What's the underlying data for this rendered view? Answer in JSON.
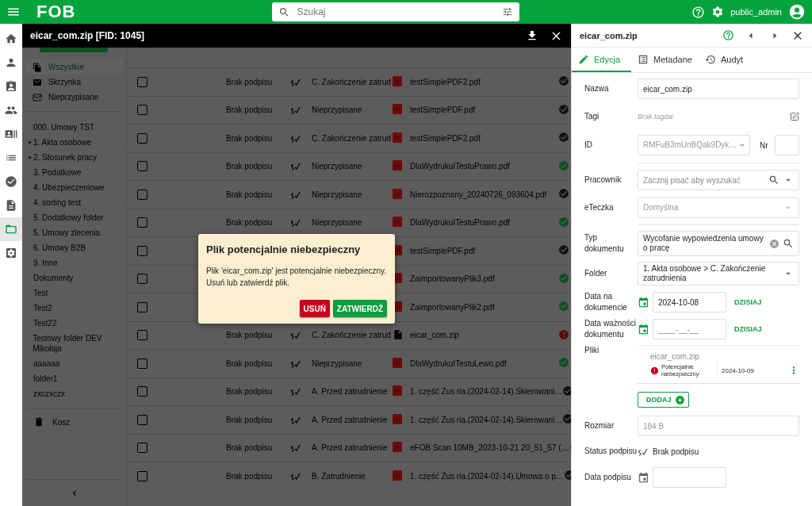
{
  "topbar": {
    "logo": "FOB",
    "search": {
      "placeholder": "Szukaj"
    },
    "user": "public_admin"
  },
  "rail": [
    {
      "selected": false
    },
    {
      "selected": false
    },
    {
      "selected": false
    },
    {
      "selected": false
    },
    {
      "selected": false
    },
    {
      "selected": false
    },
    {
      "selected": false
    },
    {
      "selected": false
    },
    {
      "selected": true
    },
    {
      "selected": false
    }
  ],
  "viewer": {
    "title": "eicar_com.zip [FID: 1045]"
  },
  "folders": {
    "quick": [
      {
        "label": "Wszystkie",
        "selected": true
      },
      {
        "label": "Skrzynka",
        "selected": false
      },
      {
        "label": "Nieprzypisane",
        "selected": false
      }
    ],
    "tree": [
      {
        "label": "000. Umowy TST",
        "expandable": false
      },
      {
        "label": "1. Akta osobowe",
        "expandable": true
      },
      {
        "label": "2. Stosunek pracy",
        "expandable": true
      },
      {
        "label": "3. Podatkowe",
        "expandable": false
      },
      {
        "label": "4. Ubezpieczeniowe",
        "expandable": false
      },
      {
        "label": "4. sorting test",
        "expandable": false
      },
      {
        "label": "5. Dodatkowy folder",
        "expandable": false
      },
      {
        "label": "5. Umowy zlecenia",
        "expandable": false
      },
      {
        "label": "6. Umowy B2B",
        "expandable": false
      },
      {
        "label": "9. Inne",
        "expandable": false
      },
      {
        "label": "Dokumenty",
        "expandable": false
      },
      {
        "label": "Test",
        "expandable": false
      },
      {
        "label": "Test2",
        "expandable": false
      },
      {
        "label": "Test22",
        "expandable": false
      },
      {
        "label": "Testowy folder DEV Mikołaja",
        "expandable": false
      },
      {
        "label": "aaaaaa",
        "expandable": false
      },
      {
        "label": "folder1",
        "expandable": false
      },
      {
        "label": "zxczxczx",
        "expandable": false
      }
    ],
    "trash": "Kosz"
  },
  "table": {
    "rows": [
      {
        "checked": false,
        "signature": "Brak podpisu",
        "folder": "C. Zakończenie zatrud",
        "kind": "pdf",
        "file": "testSimplePDF2.pdf",
        "verified": false,
        "danger": false
      },
      {
        "checked": false,
        "signature": "Brak podpisu",
        "folder": "Nieprzypisane",
        "kind": "pdf",
        "file": "testSimplePDF.pdf",
        "verified": false,
        "danger": false
      },
      {
        "checked": false,
        "signature": "Brak podpisu",
        "folder": "C. Zakończenie zatrud",
        "kind": "pdf",
        "file": "testSimplePDF2.pdf",
        "verified": false,
        "danger": false
      },
      {
        "checked": false,
        "signature": "Brak podpisu",
        "folder": "Nieprzypisane",
        "kind": "pdf",
        "file": "DlaWydrukuITestuPrawo.pdf",
        "verified": true,
        "danger": false
      },
      {
        "checked": false,
        "signature": "Brak podpisu",
        "folder": "Nieprzypisane",
        "kind": "pdf",
        "file": "Nierozpoznany_20240726_093604.pdf",
        "verified": false,
        "danger": false
      },
      {
        "checked": false,
        "signature": "Brak podpisu",
        "folder": "Nieprzypisane",
        "kind": "pdf",
        "file": "DlaWydrukuITestuPrawo.pdf",
        "verified": true,
        "danger": false
      },
      {
        "checked": false,
        "kind": "pdf",
        "file": "testSimplePDF.pdf",
        "verified": false,
        "danger": false
      },
      {
        "checked": false,
        "kind": "pdf",
        "file": "ZaimportowanyPlik3.pdf",
        "verified": true,
        "danger": false
      },
      {
        "checked": false,
        "kind": "pdf",
        "file": "ZaimportowanyPlik2.pdf",
        "verified": true,
        "danger": false
      },
      {
        "checked": false,
        "signature": "Brak podpisu",
        "folder": "C. Zakończenie zatrud",
        "kind": "file",
        "file": "eicar_com.zip",
        "danger": true
      },
      {
        "checked": false,
        "signature": "Brak podpisu",
        "folder": "Nieprzypisane",
        "kind": "pdf",
        "file": "DlaWydrukuITestuLewo.pdf",
        "verified": true,
        "danger": false
      },
      {
        "checked": false,
        "signature": "Brak podpisu",
        "folder": "A. Przed zatrudnienie",
        "kind": "pdf",
        "file": "1. część Zus ria.(2024-02-14).Skierowani…",
        "verified": false,
        "danger": false
      },
      {
        "checked": false,
        "signature": "Brak podpisu",
        "folder": "A. Przed zatrudnienie",
        "kind": "pdf",
        "file": "1. część Zus ria.(2024-02-14).Skierowani…",
        "verified": false,
        "danger": false
      },
      {
        "checked": false,
        "signature": "Brak podpisu",
        "folder": "A. Przed zatrudnienie",
        "kind": "pdf",
        "file": "eFOB Scan 10MB_2023-10-21 20_51_57 (…",
        "verified": false,
        "danger": false
      },
      {
        "checked": false,
        "signature": "Brak podpisu",
        "folder": "B. Zatrudnienie",
        "kind": "pdf",
        "file": "1. część Zus ria.(2024-02-14).Umowa o p…",
        "verified": false,
        "danger": false
      }
    ]
  },
  "dialog": {
    "title": "Plik potencjalnie niebezpieczny",
    "message": "Plik 'eicar_com.zip' jest potencjalnie niebezpieczny. Usuń lub zatwierdź plik.",
    "buttons": [
      {
        "label": "USUŃ",
        "kind": "danger"
      },
      {
        "label": "ZATWIERDŹ",
        "kind": "confirm"
      }
    ]
  },
  "panel": {
    "title": "eicar_com.zip",
    "tabs": [
      {
        "label": "Edycja",
        "selected": true
      },
      {
        "label": "Metadane",
        "selected": false
      },
      {
        "label": "Audyt",
        "selected": false
      }
    ],
    "fields": [
      {
        "kind": "input",
        "label": "Nazwa",
        "value": "eicar_com.zip",
        "disabled": false
      },
      {
        "kind": "tags",
        "label": "Tagi",
        "empty_text": "Brak tagów"
      },
      {
        "kind": "id",
        "label": "ID",
        "value": "RMFuB3mUnBQak9Dyk…",
        "nr_label": "Nr"
      },
      {
        "kind": "divider"
      },
      {
        "kind": "search",
        "label": "Pracownik",
        "placeholder": "Zacznij pisać aby wyszukać",
        "clearable": false
      },
      {
        "kind": "select",
        "label": "eTeczka",
        "value": "Domyślna",
        "disabled": true
      },
      {
        "kind": "divider"
      },
      {
        "kind": "search",
        "label": "Typ dokumentu",
        "value": "Wycofanie wypowiedzenia umowy o pracę",
        "clearable": true
      },
      {
        "kind": "select",
        "label": "Folder",
        "value": "1. Akta osobowe > C. Zakończenie zatrudnienia",
        "disabled": false
      },
      {
        "kind": "date",
        "label": "Data na dokumencie",
        "value": "2024-10-08",
        "today": "DZISIAJ",
        "disabled": false
      },
      {
        "kind": "date",
        "label": "Data ważności dokumentu",
        "placeholder": "____-__-__",
        "today": "DZISIAJ",
        "disabled": false
      },
      {
        "kind": "files",
        "label": "Pliki",
        "files": [
          {
            "name": "eicar_com.zip",
            "warning": "Potencjalnie niebezpieczny",
            "date": "2024-10-09"
          }
        ],
        "add": "DODAJ"
      },
      {
        "kind": "input",
        "label": "Rozmiar",
        "value": "184 B",
        "disabled": true
      },
      {
        "kind": "signature",
        "label": "Status podpisu",
        "value": "Brak podpisu"
      },
      {
        "kind": "date",
        "label": "Data podpisu",
        "disabled": true
      }
    ]
  }
}
